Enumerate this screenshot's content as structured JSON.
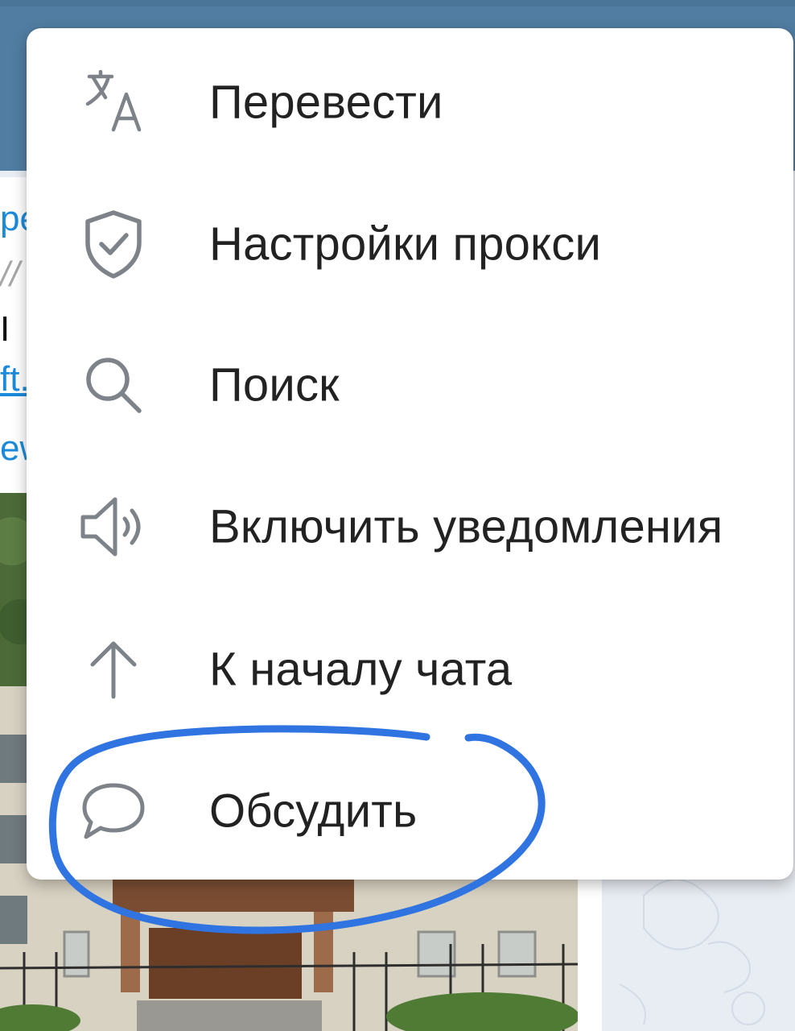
{
  "app": {
    "header_color": "#517da2",
    "chat_background": "#e8edf3",
    "link_color": "#1c8adb"
  },
  "background_message": {
    "fragments": [
      "ре",
      "//",
      "І",
      "ft.",
      "ew"
    ]
  },
  "menu": {
    "items": [
      {
        "label": "Перевести",
        "icon": "translate-icon"
      },
      {
        "label": "Настройки прокси",
        "icon": "shield-check-icon"
      },
      {
        "label": "Поиск",
        "icon": "search-icon"
      },
      {
        "label": "Включить уведомления",
        "icon": "speaker-icon"
      },
      {
        "label": "К началу чата",
        "icon": "arrow-up-icon"
      },
      {
        "label": "Обсудить",
        "icon": "chat-bubble-icon"
      }
    ],
    "icon_color": "#7d8389",
    "text_color": "#222222"
  },
  "annotation": {
    "type": "hand-drawn circle around menu item",
    "target": "Обсудить",
    "color": "#2f74e0"
  }
}
